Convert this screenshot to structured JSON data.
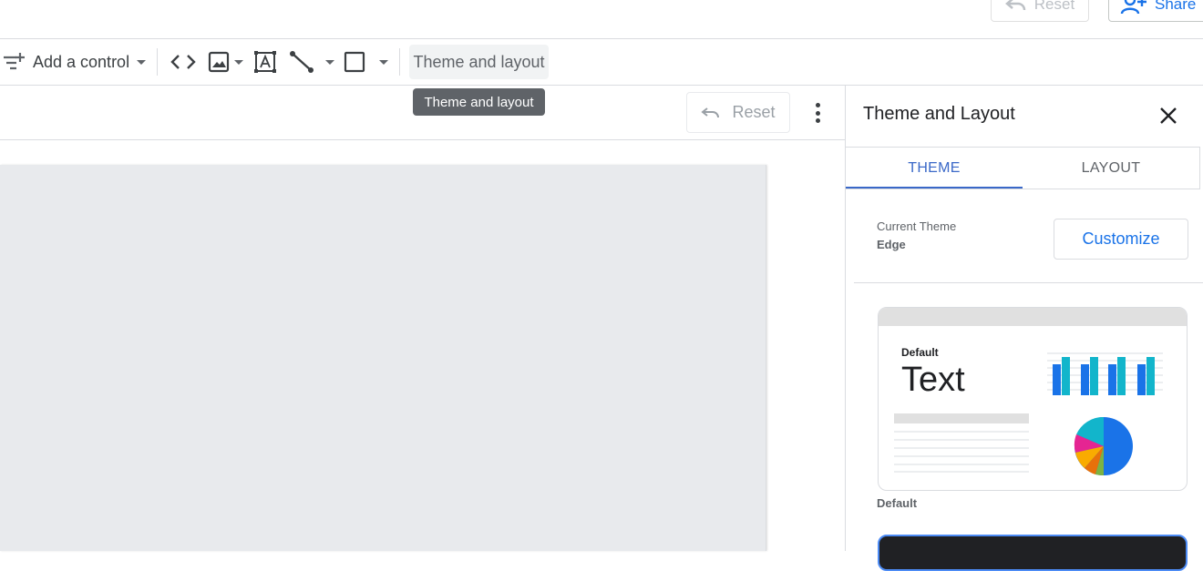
{
  "header": {
    "reset_label": "Reset",
    "share_label": "Share"
  },
  "toolbar": {
    "add_control_label": "Add a control",
    "theme_button_label": "Theme and layout",
    "tooltip": "Theme and layout"
  },
  "canvas": {
    "reset_label": "Reset"
  },
  "panel": {
    "title": "Theme and Layout",
    "tabs": [
      {
        "label": "THEME",
        "active": true
      },
      {
        "label": "LAYOUT",
        "active": false
      }
    ],
    "current_theme_label": "Current Theme",
    "current_theme_name": "Edge",
    "customize_label": "Customize",
    "theme_cards": [
      {
        "small_label": "Default",
        "big_label": "Text",
        "caption": "Default"
      }
    ]
  },
  "colors": {
    "accent": "#1a73e8",
    "tab_active": "#3a68c8",
    "tooltip_bg": "#5f6368",
    "canvas_bg": "#e8eaed",
    "bar_primary": "#1a73e8",
    "bar_secondary": "#12b5cb"
  },
  "icons": {
    "undo": "undo-icon",
    "share": "person-add-icon",
    "filter_add": "filter-add-icon",
    "code": "code-icon",
    "image": "image-icon",
    "text_box": "text-box-icon",
    "line": "line-icon",
    "rectangle": "rectangle-icon",
    "more": "more-vert-icon",
    "close": "close-icon"
  }
}
